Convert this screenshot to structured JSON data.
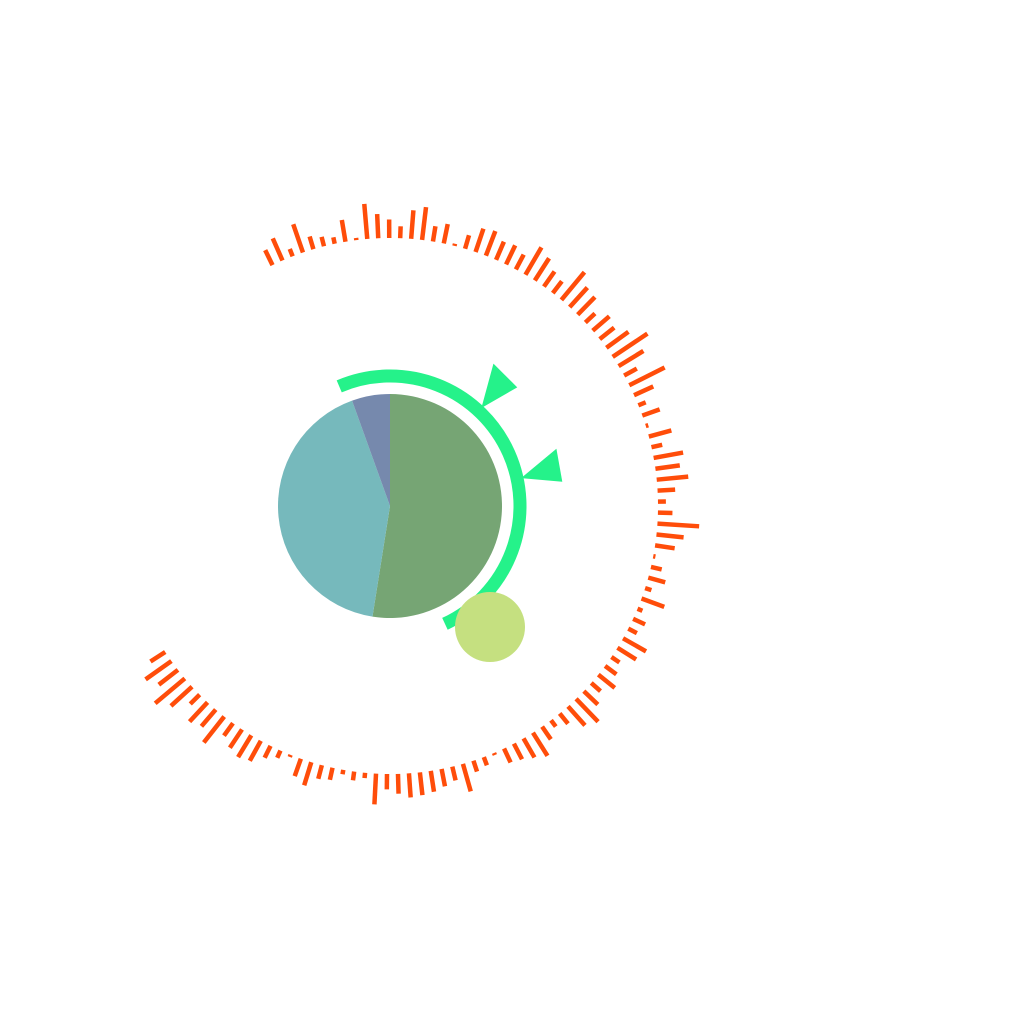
{
  "chart_data": [
    {
      "type": "pie",
      "title": "",
      "slices": [
        {
          "value": 52.5,
          "color": "#76a574"
        },
        {
          "value": 42.0,
          "color": "#76b9bc"
        },
        {
          "value": 5.5,
          "color": "#7689ad"
        }
      ]
    },
    {
      "type": "bar",
      "layout": "radial",
      "title": "",
      "color": "#ff4d0a",
      "ylim": [
        0,
        1
      ],
      "values": [
        0.38,
        0.55,
        0.18,
        0.68,
        0.3,
        0.22,
        0.15,
        0.5,
        0.05,
        0.8,
        0.55,
        0.42,
        0.27,
        0.65,
        0.75,
        0.35,
        0.45,
        0.05,
        0.32,
        0.56,
        0.6,
        0.45,
        0.48,
        0.38,
        0.72,
        0.6,
        0.42,
        0.34,
        0.82,
        0.6,
        0.56,
        0.3,
        0.5,
        0.42,
        0.62,
        0.95,
        0.66,
        0.33,
        0.9,
        0.48,
        0.18,
        0.42,
        0.06,
        0.53,
        0.25,
        0.68,
        0.56,
        0.72,
        0.4,
        0.18,
        0.33,
        0.95,
        0.62,
        0.45,
        0.05,
        0.25,
        0.4,
        0.15,
        0.55,
        0.12,
        0.3,
        0.22,
        0.6,
        0.5,
        0.22,
        0.32,
        0.48,
        0.28,
        0.44,
        0.72,
        0.58,
        0.3,
        0.18,
        0.35,
        0.62,
        0.5,
        0.4,
        0.35,
        0.05,
        0.2,
        0.26,
        0.65,
        0.32,
        0.4,
        0.48,
        0.52,
        0.55,
        0.45,
        0.35,
        0.7,
        0.12,
        0.2,
        0.1,
        0.28,
        0.32,
        0.55,
        0.42,
        0.05,
        0.18,
        0.3,
        0.52,
        0.58,
        0.5,
        0.35,
        0.75,
        0.5,
        0.6,
        0.3,
        0.65,
        0.88,
        0.55,
        0.72,
        0.4
      ]
    },
    {
      "type": "other",
      "title": "",
      "ring_color": "#25f28a",
      "pointer_count": 2,
      "marker_color": "#c5e080"
    }
  ]
}
